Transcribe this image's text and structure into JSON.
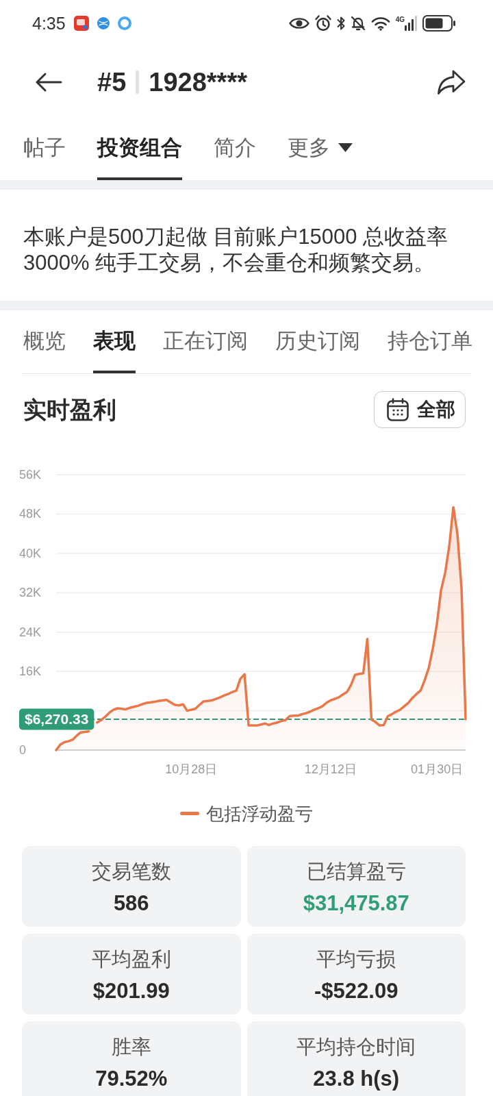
{
  "status_bar": {
    "time": "4:35",
    "network": "4G"
  },
  "header": {
    "rank": "#5",
    "account": "1928****"
  },
  "profile_tabs": [
    {
      "label": "帖子",
      "kind": "tab",
      "selected": false
    },
    {
      "label": "投资组合",
      "kind": "tab",
      "selected": true
    },
    {
      "label": "简介",
      "kind": "tab",
      "selected": false
    },
    {
      "label": "更多",
      "kind": "dropdown",
      "selected": false
    }
  ],
  "strategy": {
    "text": "本账户是500刀起做 目前账户15000 总收益率 3000% 纯手工交易，不会重仓和频繁交易。"
  },
  "portfolio_tabs": [
    {
      "label": "概览",
      "selected": false
    },
    {
      "label": "表现",
      "selected": true
    },
    {
      "label": "正在订阅",
      "selected": false
    },
    {
      "label": "历史订阅",
      "selected": false
    },
    {
      "label": "持仓订单",
      "selected": false
    }
  ],
  "profit_section": {
    "range_button": "全部",
    "chart_data": {
      "type": "area",
      "title": "实时盈利",
      "grid": true,
      "categories": [
        null,
        null,
        null,
        null,
        null,
        null,
        null,
        null,
        null,
        null,
        null,
        null,
        null,
        null,
        null,
        null,
        null,
        null,
        null,
        null,
        null,
        null,
        null,
        null,
        null,
        null,
        null,
        null,
        null,
        null,
        null,
        null,
        null,
        "10月28日",
        null,
        null,
        null,
        null,
        null,
        null,
        null,
        null,
        null,
        null,
        null,
        null,
        null,
        null,
        null,
        null,
        null,
        null,
        null,
        null,
        null,
        null,
        null,
        null,
        null,
        null,
        null,
        null,
        null,
        null,
        null,
        null,
        null,
        "12月12日",
        null,
        null,
        null,
        null,
        null,
        null,
        null,
        null,
        null,
        null,
        null,
        null,
        null,
        null,
        null,
        null,
        null,
        null,
        null,
        null,
        null,
        null,
        null,
        null,
        null,
        "01月30日",
        null,
        null,
        null,
        null,
        null,
        null,
        null
      ],
      "series": [
        {
          "name": "包括浮动盈亏",
          "color": "#e8774a",
          "values": [
            0,
            1100,
            1600,
            1800,
            2100,
            2900,
            3600,
            3700,
            3800,
            null,
            5600,
            6100,
            6800,
            7600,
            8200,
            8500,
            8400,
            8300,
            8600,
            8800,
            9000,
            9300,
            9600,
            9700,
            9800,
            10000,
            10100,
            10200,
            9700,
            9200,
            9100,
            9300,
            8000,
            8200,
            8400,
            9200,
            9900,
            10000,
            10100,
            10400,
            10700,
            11100,
            11400,
            11800,
            12100,
            14500,
            15400,
            5000,
            5000,
            5000,
            5200,
            5400,
            5100,
            5400,
            5600,
            5900,
            6100,
            6900,
            7000,
            7000,
            7300,
            7500,
            7800,
            8200,
            8500,
            8900,
            9600,
            10100,
            10400,
            10700,
            11300,
            11800,
            13200,
            15300,
            15500,
            15600,
            22600,
            6200,
            5700,
            5000,
            5100,
            6900,
            7300,
            7800,
            8200,
            8900,
            9600,
            10600,
            11400,
            12100,
            14200,
            16700,
            20700,
            25700,
            32500,
            36000,
            41500,
            49400,
            44000,
            33000,
            6270
          ]
        }
      ],
      "ylim": [
        0,
        56000
      ],
      "yticks": [
        {
          "value": 0,
          "label": "0"
        },
        {
          "value": 16000,
          "label": "16K"
        },
        {
          "value": 24000,
          "label": "24K"
        },
        {
          "value": 32000,
          "label": "32K"
        },
        {
          "value": 40000,
          "label": "40K"
        },
        {
          "value": 48000,
          "label": "48K"
        },
        {
          "value": 56000,
          "label": "56K"
        }
      ],
      "ref_lines": [
        {
          "axis": "y",
          "value": 6270.33,
          "label": "$6,270.33"
        }
      ]
    }
  },
  "stats": [
    {
      "label": "交易笔数",
      "value": "586",
      "color": "#2b2b2b"
    },
    {
      "label": "已结算盈亏",
      "value": "$31,475.87",
      "color": "#2f9e72"
    },
    {
      "label": "平均盈利",
      "value": "$201.99",
      "color": "#2b2b2b"
    },
    {
      "label": "平均亏损",
      "value": "-$522.09",
      "color": "#2b2b2b"
    },
    {
      "label": "胜率",
      "value": "79.52%",
      "color": "#2b2b2b"
    },
    {
      "label": "平均持仓时间",
      "value": "23.8 h(s)",
      "color": "#2b2b2b"
    }
  ]
}
